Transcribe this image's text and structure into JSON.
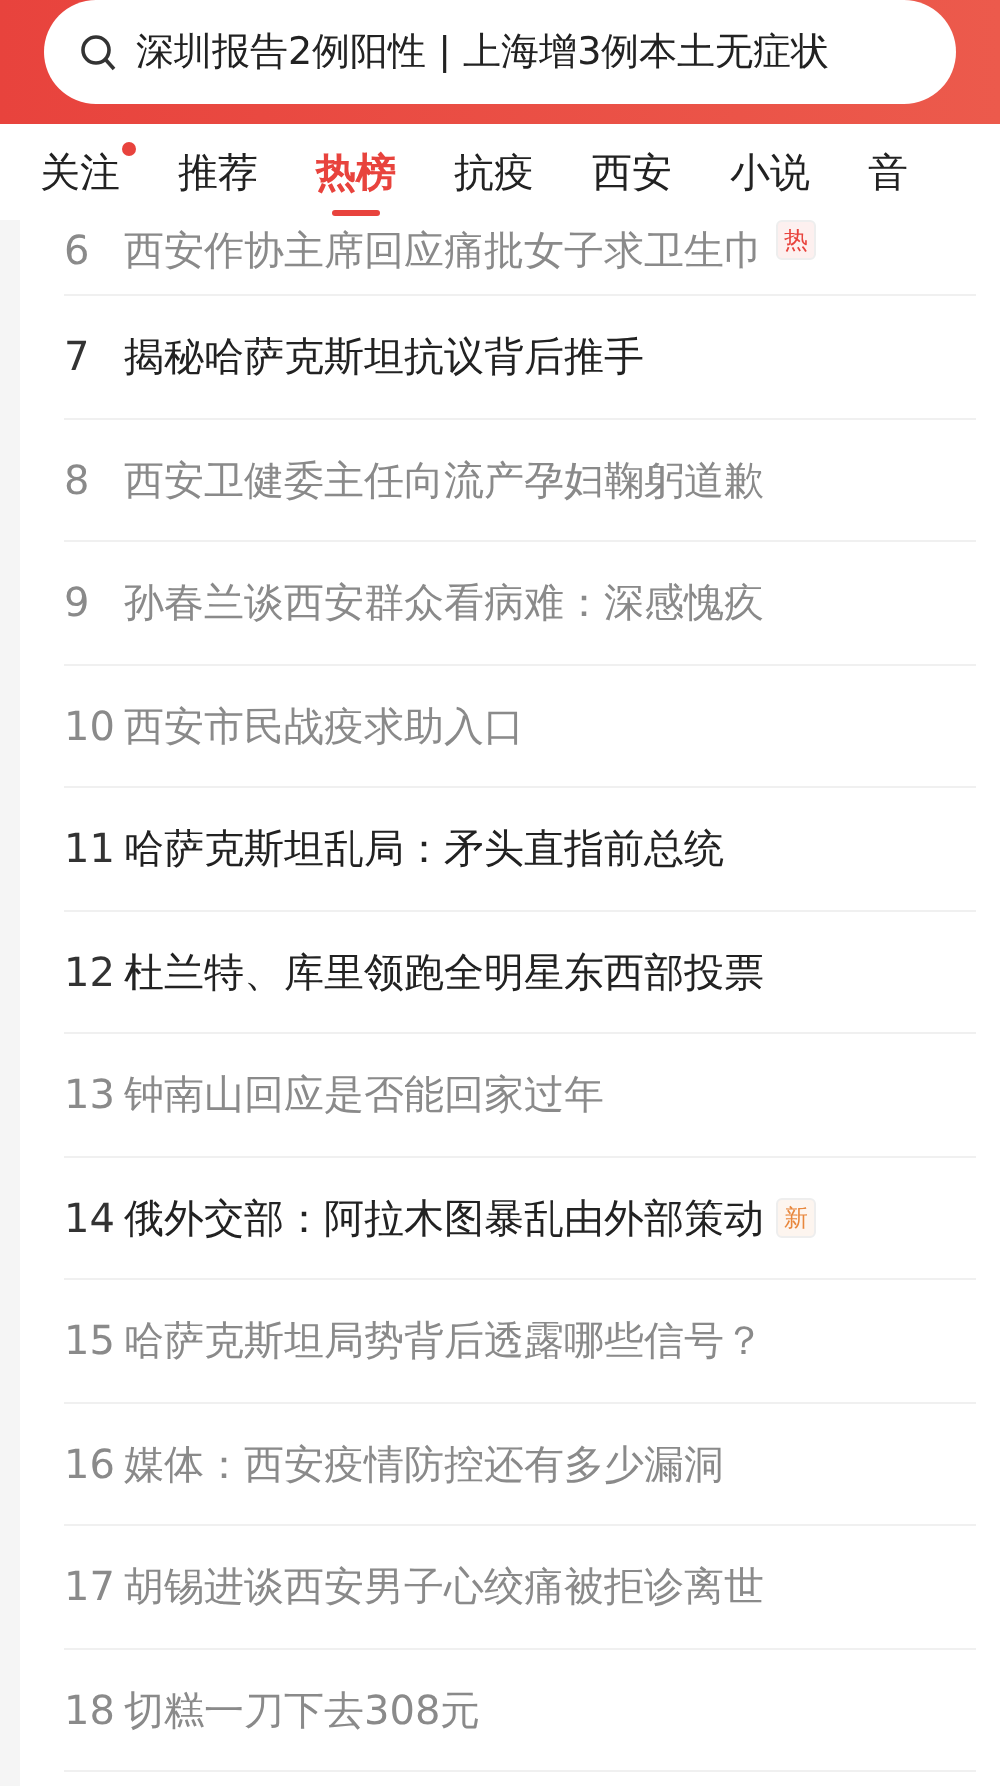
{
  "search": {
    "value": "深圳报告2例阳性 | 上海增3例本土无症状"
  },
  "tabs": [
    {
      "label": "关注",
      "selected": false,
      "dot": true
    },
    {
      "label": "推荐",
      "selected": false,
      "dot": false
    },
    {
      "label": "热榜",
      "selected": true,
      "dot": false
    },
    {
      "label": "抗疫",
      "selected": false,
      "dot": false
    },
    {
      "label": "西安",
      "selected": false,
      "dot": false
    },
    {
      "label": "小说",
      "selected": false,
      "dot": false
    },
    {
      "label": "音",
      "selected": false,
      "dot": false
    }
  ],
  "hot_list": [
    {
      "rank": "6",
      "title": "西安作协主席回应痛批女子求卫生巾",
      "read": true,
      "badge": {
        "text": "热",
        "kind": "hot"
      }
    },
    {
      "rank": "7",
      "title": "揭秘哈萨克斯坦抗议背后推手",
      "read": false
    },
    {
      "rank": "8",
      "title": "西安卫健委主任向流产孕妇鞠躬道歉",
      "read": true
    },
    {
      "rank": "9",
      "title": "孙春兰谈西安群众看病难：深感愧疚",
      "read": true
    },
    {
      "rank": "10",
      "title": "西安市民战疫求助入口",
      "read": true
    },
    {
      "rank": "11",
      "title": "哈萨克斯坦乱局：矛头直指前总统",
      "read": false
    },
    {
      "rank": "12",
      "title": "杜兰特、库里领跑全明星东西部投票",
      "read": false
    },
    {
      "rank": "13",
      "title": "钟南山回应是否能回家过年",
      "read": true
    },
    {
      "rank": "14",
      "title": "俄外交部：阿拉木图暴乱由外部策动",
      "read": false,
      "badge": {
        "text": "新",
        "kind": "new"
      }
    },
    {
      "rank": "15",
      "title": "哈萨克斯坦局势背后透露哪些信号？",
      "read": true
    },
    {
      "rank": "16",
      "title": "媒体：西安疫情防控还有多少漏洞",
      "read": true
    },
    {
      "rank": "17",
      "title": "胡锡进谈西安男子心绞痛被拒诊离世",
      "read": true
    },
    {
      "rank": "18",
      "title": "切糕一刀下去308元",
      "read": true
    }
  ]
}
